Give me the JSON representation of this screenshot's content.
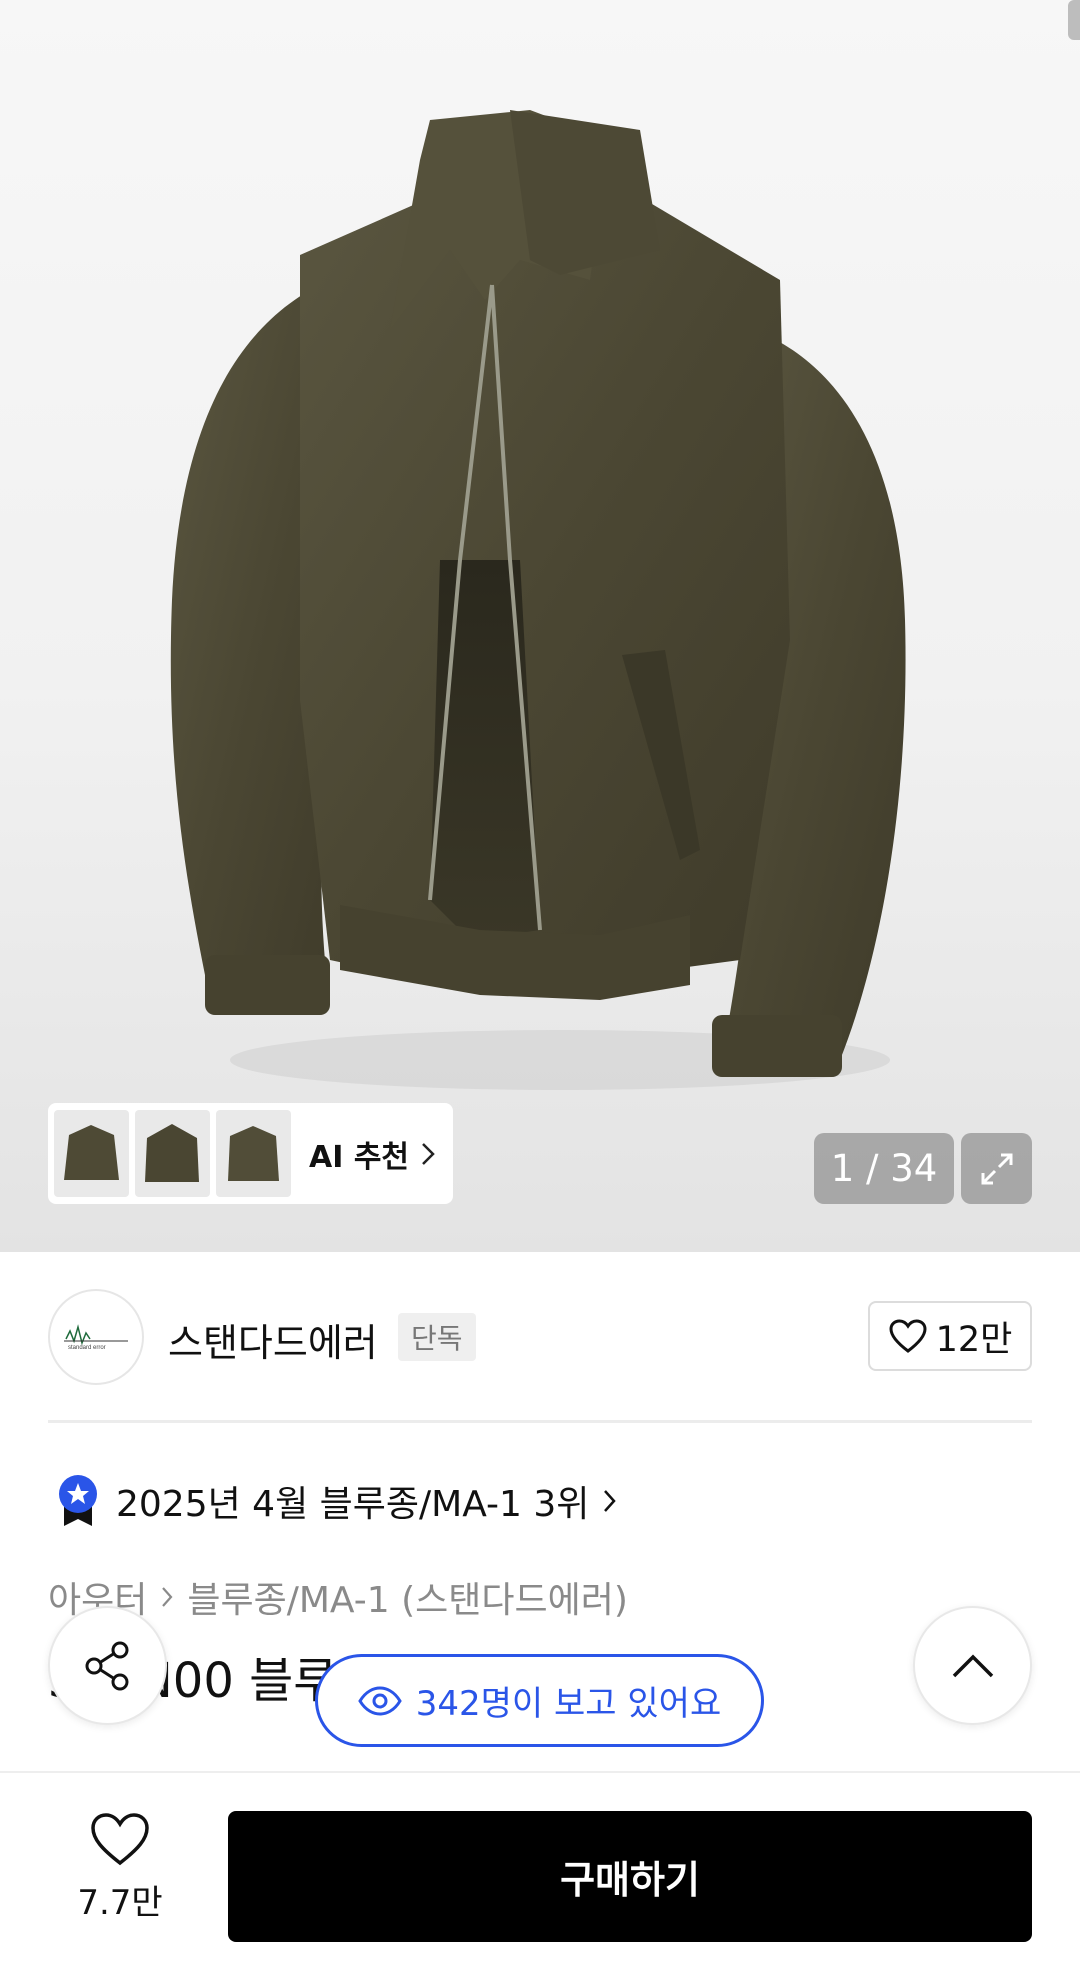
{
  "gallery": {
    "counter": "1 / 34",
    "ai_recommend_label": "AI 추천",
    "thumbnails": [
      "thumb-1",
      "thumb-2",
      "thumb-3"
    ]
  },
  "brand": {
    "name": "스탠다드에러",
    "badge": "단독",
    "likes": "12만",
    "logo_text": "standard error"
  },
  "ranking": {
    "text": "2025년 4월 블루종/MA-1 3위"
  },
  "breadcrumb": {
    "level1": "아우터",
    "level2": "블루종/MA-1 (스탠다드에러)"
  },
  "product": {
    "title": "STAN00 블루종 이드 자켓 카키"
  },
  "viewers": {
    "text": "342명이 보고 있어요"
  },
  "bottom_bar": {
    "wish_count": "7.7만",
    "buy_label": "구매하기"
  },
  "colors": {
    "accent_blue": "#2a55e8",
    "jacket_khaki": "#4e4a35",
    "buy_button": "#000000"
  }
}
